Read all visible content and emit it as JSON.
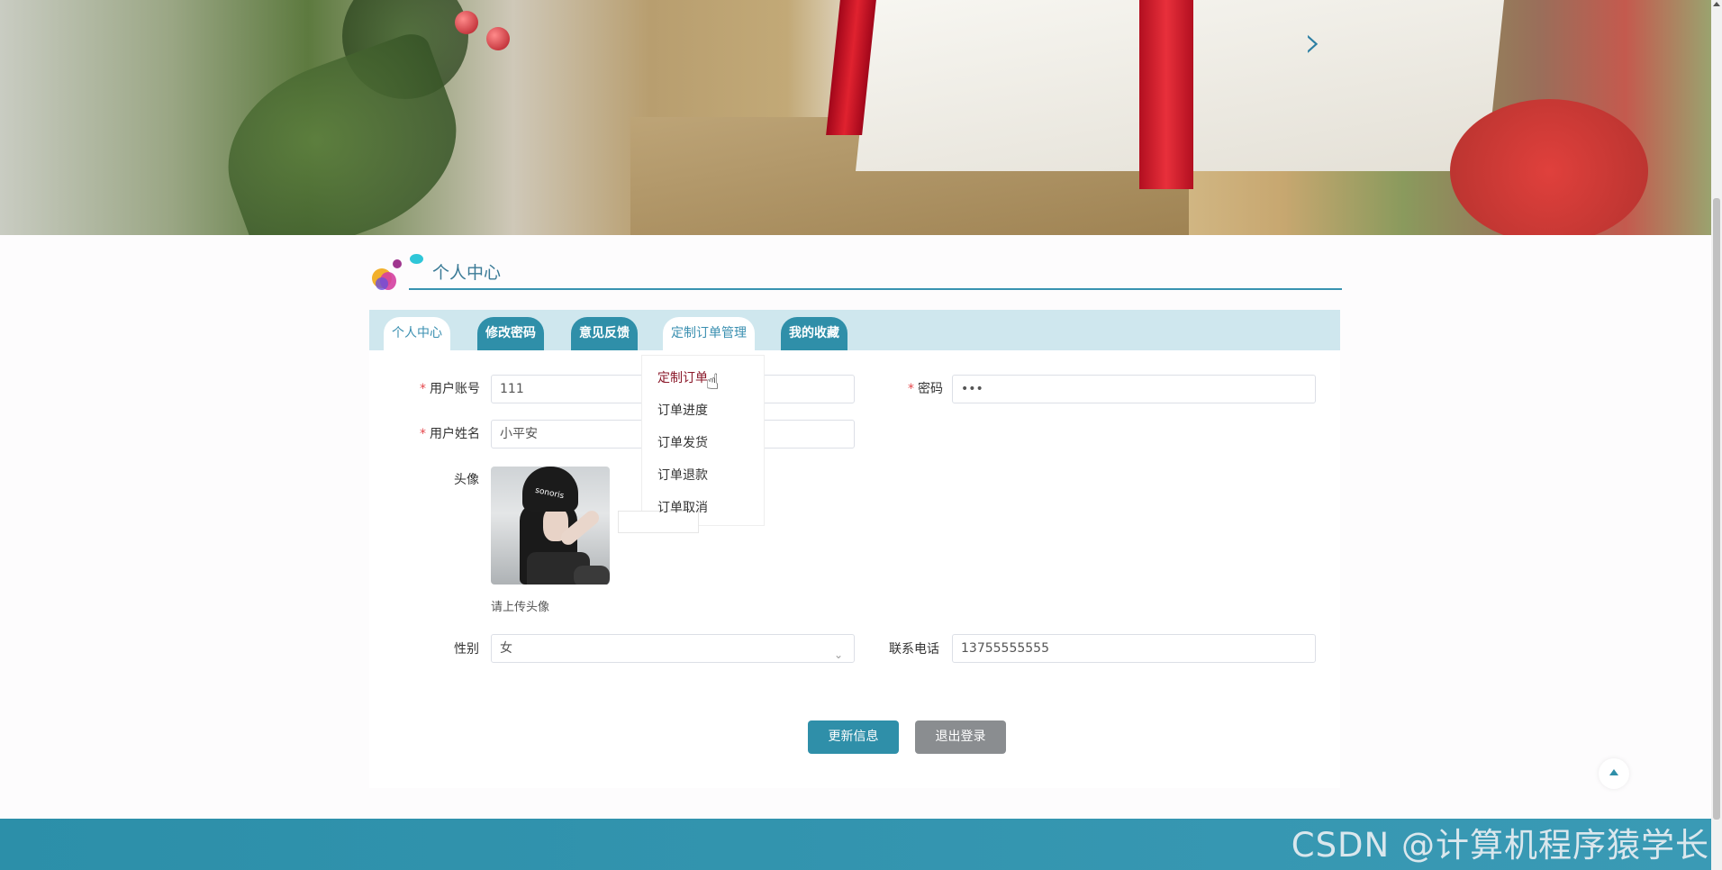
{
  "banner": {
    "next_arrow_glyph": "›"
  },
  "section": {
    "title": "个人中心"
  },
  "tabs": [
    {
      "label": "个人中心",
      "state": "active"
    },
    {
      "label": "修改密码",
      "state": "normal"
    },
    {
      "label": "意见反馈",
      "state": "normal"
    },
    {
      "label": "定制订单管理",
      "state": "hover"
    },
    {
      "label": "我的收藏",
      "state": "normal"
    }
  ],
  "dropdown": {
    "items": [
      {
        "label": "定制订单",
        "active": true
      },
      {
        "label": "订单进度",
        "active": false
      },
      {
        "label": "订单发货",
        "active": false
      },
      {
        "label": "订单退款",
        "active": false
      },
      {
        "label": "订单取消",
        "active": false
      }
    ]
  },
  "form": {
    "username_label": "用户账号",
    "username_value": "111",
    "password_label": "密码",
    "password_value": "•••",
    "realname_label": "用户姓名",
    "realname_value": "小平安",
    "avatar_label": "头像",
    "avatar_text": "sonoris",
    "avatar_hint": "请上传头像",
    "gender_label": "性别",
    "gender_value": "女",
    "phone_label": "联系电话",
    "phone_value": "13755555555",
    "required_mark": "*"
  },
  "buttons": {
    "update": "更新信息",
    "logout": "退出登录"
  },
  "watermark": "CSDN @计算机程序猿学长",
  "colors": {
    "accent": "#2f8fa9",
    "tab_bar_bg": "#cfe7ee",
    "required": "#e5484d",
    "dropdown_active": "#8b1a2b",
    "secondary_button": "#8a8d90"
  }
}
